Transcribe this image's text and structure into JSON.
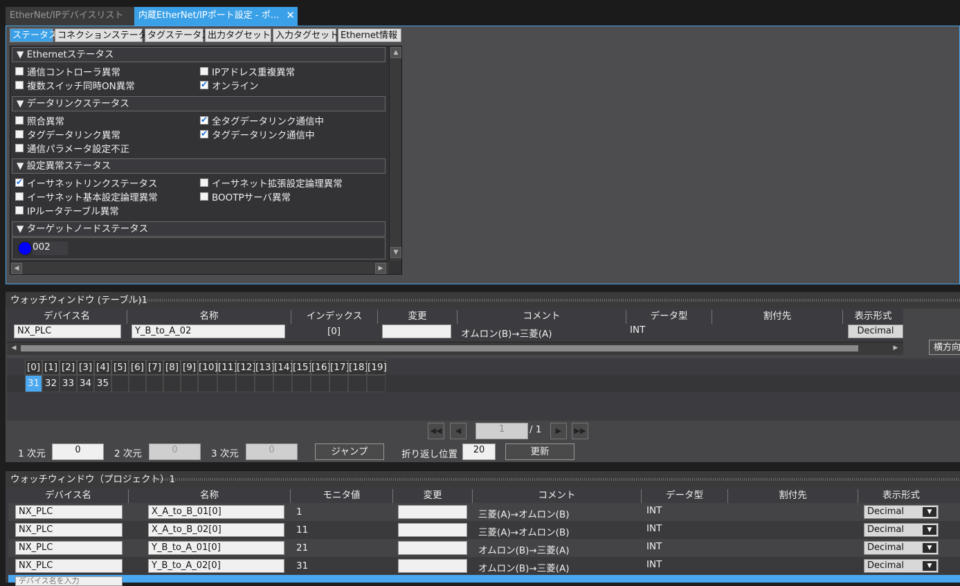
{
  "doc_tabs": {
    "inactive": "EtherNet/IPデバイスリスト",
    "active": "内蔵EtherNet/IPポート設定 - ポ...",
    "close": "✕"
  },
  "status_tabs": [
    "ステータス",
    "コネクションステータス",
    "タグステータス",
    "出力タグセット",
    "入力タグセット",
    "Ethernet情報"
  ],
  "sections": {
    "ethernet": {
      "title": "▼ Ethernetステータス",
      "items": [
        {
          "label": "通信コントローラ異常",
          "checked": false
        },
        {
          "label": "IPアドレス重複異常",
          "checked": false
        },
        {
          "label": "複数スイッチ同時ON異常",
          "checked": false
        },
        {
          "label": "オンライン",
          "checked": true
        }
      ]
    },
    "datalink": {
      "title": "▼ データリンクステータス",
      "items": [
        {
          "label": "照合異常",
          "checked": false
        },
        {
          "label": "全タグデータリンク通信中",
          "checked": true
        },
        {
          "label": "タグデータリンク異常",
          "checked": false
        },
        {
          "label": "タグデータリンク通信中",
          "checked": true
        },
        {
          "label": "通信パラメータ設定不正",
          "checked": false
        }
      ]
    },
    "config": {
      "title": "▼ 設定異常ステータス",
      "items": [
        {
          "label": "イーサネットリンクステータス",
          "checked": true
        },
        {
          "label": "イーサネット拡張設定論理異常",
          "checked": false
        },
        {
          "label": "イーサネット基本設定論理異常",
          "checked": false
        },
        {
          "label": "BOOTPサーバ異常",
          "checked": false
        },
        {
          "label": "IPルータテーブル異常",
          "checked": false
        }
      ]
    },
    "target": {
      "title": "▼ ターゲットノードステータス",
      "node": "002",
      "node_color": "#0000ff"
    }
  },
  "watch_table": {
    "title": "ウォッチウィンドウ (テーブル)1",
    "headers": [
      "デバイス名",
      "名称",
      "インデックス",
      "変更",
      "コメント",
      "データ型",
      "割付先",
      "表示形式"
    ],
    "row": {
      "device": "NX_PLC",
      "name": "Y_B_to_A_02",
      "index": "[0]",
      "change": "",
      "comment": "オムロン(B)→三菱(A)",
      "type": "INT",
      "assign": "",
      "format": "Decimal"
    },
    "side_button": "横方向",
    "array_headers": [
      "[0]",
      "[1]",
      "[2]",
      "[3]",
      "[4]",
      "[5]",
      "[6]",
      "[7]",
      "[8]",
      "[9]",
      "[10]",
      "[11]",
      "[12]",
      "[13]",
      "[14]",
      "[15]",
      "[16]",
      "[17]",
      "[18]",
      "[19]"
    ],
    "array_values": [
      "31",
      "32",
      "33",
      "34",
      "35",
      "",
      "",
      "",
      "",
      "",
      "",
      "",
      "",
      "",
      "",
      "",
      "",
      "",
      "",
      ""
    ],
    "page": {
      "current": "1",
      "total": "/ 1"
    },
    "dims": {
      "d1_label": "1 次元",
      "d1": "0",
      "d2_label": "2 次元",
      "d2": "0",
      "d3_label": "3 次元",
      "d3": "0"
    },
    "jump": "ジャンプ",
    "wrap_label": "折り返し位置",
    "wrap_value": "20",
    "update": "更新"
  },
  "watch_project": {
    "title": "ウォッチウィンドウ（プロジェクト）1",
    "headers": [
      "デバイス名",
      "名称",
      "モニタ値",
      "変更",
      "コメント",
      "データ型",
      "割付先",
      "表示形式"
    ],
    "rows": [
      {
        "device": "NX_PLC",
        "name": "X_A_to_B_01[0]",
        "value": "1",
        "comment": "三菱(A)→オムロン(B)",
        "type": "INT",
        "format": "Decimal"
      },
      {
        "device": "NX_PLC",
        "name": "X_A_to_B_02[0]",
        "value": "11",
        "comment": "三菱(A)→オムロン(B)",
        "type": "INT",
        "format": "Decimal"
      },
      {
        "device": "NX_PLC",
        "name": "Y_B_to_A_01[0]",
        "value": "21",
        "comment": "オムロン(B)→三菱(A)",
        "type": "INT",
        "format": "Decimal"
      },
      {
        "device": "NX_PLC",
        "name": "Y_B_to_A_02[0]",
        "value": "31",
        "comment": "オムロン(B)→三菱(A)",
        "type": "INT",
        "format": "Decimal"
      }
    ],
    "new_row_placeholder": "デバイス名を入力"
  }
}
